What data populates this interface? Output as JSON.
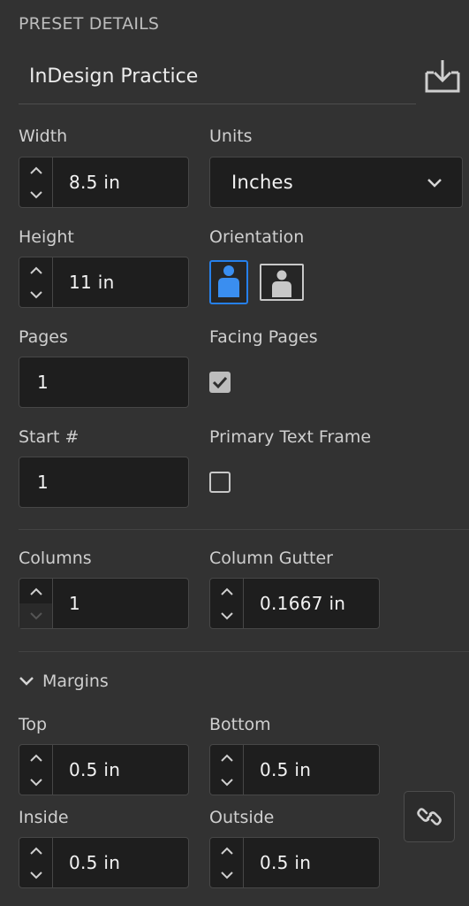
{
  "header": {
    "title": "PRESET DETAILS"
  },
  "preset": {
    "name": "InDesign Practice"
  },
  "width": {
    "label": "Width",
    "value": "8.5 in"
  },
  "units": {
    "label": "Units",
    "value": "Inches"
  },
  "height": {
    "label": "Height",
    "value": "11 in"
  },
  "orientation": {
    "label": "Orientation",
    "selected": "portrait",
    "options": [
      "portrait",
      "landscape"
    ]
  },
  "pages": {
    "label": "Pages",
    "value": "1"
  },
  "facing_pages": {
    "label": "Facing Pages",
    "checked": true
  },
  "start": {
    "label": "Start #",
    "value": "1"
  },
  "primary_text_frame": {
    "label": "Primary Text Frame",
    "checked": false
  },
  "columns": {
    "label": "Columns",
    "value": "1"
  },
  "column_gutter": {
    "label": "Column Gutter",
    "value": "0.1667 in"
  },
  "margins": {
    "label": "Margins",
    "expanded": true,
    "top": {
      "label": "Top",
      "value": "0.5 in"
    },
    "bottom": {
      "label": "Bottom",
      "value": "0.5 in"
    },
    "inside": {
      "label": "Inside",
      "value": "0.5 in"
    },
    "outside": {
      "label": "Outside",
      "value": "0.5 in"
    },
    "linked": false
  },
  "colors": {
    "background": "#323232",
    "field": "#1e1e1e",
    "accent": "#2680eb"
  },
  "icons": [
    "save-preset-icon",
    "chevron-up-icon",
    "chevron-down-icon",
    "portrait-icon",
    "landscape-icon",
    "checkmark-icon",
    "link-icon"
  ]
}
